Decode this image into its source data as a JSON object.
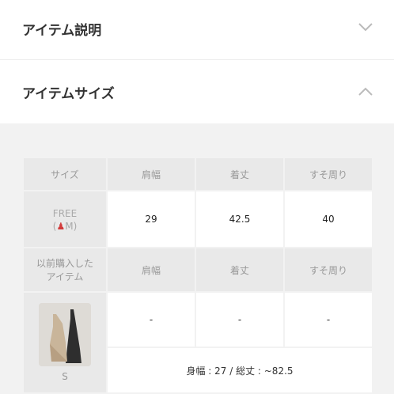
{
  "sections": {
    "description_title": "アイテム説明",
    "size_title": "アイテムサイズ"
  },
  "table": {
    "headers": [
      "サイズ",
      "肩幅",
      "着丈",
      "すそ周り"
    ],
    "free_row": {
      "label": "FREE",
      "model_size": "M",
      "values": [
        "29",
        "42.5",
        "40"
      ]
    },
    "prev_header": {
      "label_line1": "以前購入した",
      "label_line2": "アイテム",
      "cols": [
        "肩幅",
        "着丈",
        "すそ周り"
      ]
    },
    "prev_item": {
      "size": "S",
      "values": [
        "-",
        "-",
        "-"
      ],
      "note": "身幅 : 27 / 総丈 : ~82.5"
    }
  },
  "colors": {
    "person_icon": "#d23b3b",
    "panel_bg": "#f2f2f2",
    "header_cell_bg": "#e9e9e9"
  },
  "icons": {
    "description_chevron": "chevron-down-icon",
    "size_chevron": "chevron-up-icon",
    "person": "person-icon"
  }
}
